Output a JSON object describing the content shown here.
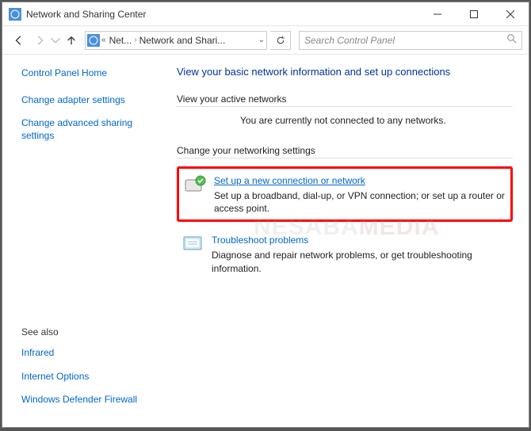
{
  "window": {
    "title": "Network and Sharing Center"
  },
  "breadcrumb": {
    "part1": "Net...",
    "part2": "Network and Shari..."
  },
  "search": {
    "placeholder": "Search Control Panel"
  },
  "sidebar": {
    "home": "Control Panel Home",
    "links": [
      "Change adapter settings",
      "Change advanced sharing settings"
    ],
    "seeAlsoHeading": "See also",
    "seeAlso": [
      "Infrared",
      "Internet Options",
      "Windows Defender Firewall"
    ]
  },
  "main": {
    "title": "View your basic network information and set up connections",
    "activeHeading": "View your active networks",
    "activeStatus": "You are currently not connected to any networks.",
    "changeHeading": "Change your networking settings",
    "items": [
      {
        "link": "Set up a new connection or network",
        "desc": "Set up a broadband, dial-up, or VPN connection; or set up a router or access point."
      },
      {
        "link": "Troubleshoot problems",
        "desc": "Diagnose and repair network problems, or get troubleshooting information."
      }
    ]
  },
  "watermark": {
    "a": "NESABA",
    "b": "MEDIA"
  }
}
